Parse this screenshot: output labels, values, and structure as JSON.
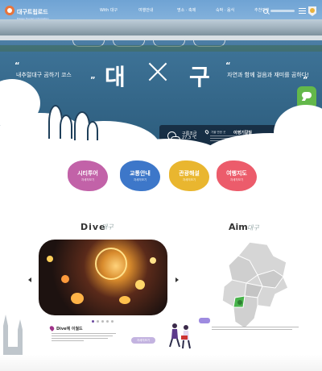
{
  "header": {
    "logo_text": "대구트립로드",
    "logo_sub": "Daegu Tourism Infomation",
    "nav": [
      "With 대구",
      "여행안내",
      "명소 · 축제",
      "숙박 · 음식",
      "추천여행"
    ]
  },
  "hero": {
    "tag_left": "내추럴대구 곰하기 코스",
    "tag_right": "자연과 함께 걸음과 재미를 곰하다!",
    "title_left": "대",
    "title_right": "구",
    "quote_open": "“",
    "quote_close": "”"
  },
  "weather": {
    "label": "구름조금",
    "temp": "27.3 ℃",
    "place_sub": "가볼 만한 곳",
    "place": "이영기갈질"
  },
  "categories": [
    {
      "label": "시티투어",
      "sub": "자세히보기",
      "color": "#c262a8"
    },
    {
      "label": "교통안내",
      "sub": "자세히보기",
      "color": "#3d77c9"
    },
    {
      "label": "관광해설",
      "sub": "자세히보기",
      "color": "#e9b62f"
    },
    {
      "label": "여행지도",
      "sub": "자세히보기",
      "color": "#ec5c6b"
    }
  ],
  "dive": {
    "title_a": "Dive",
    "title_b": "대구",
    "place_name": "Dive예 이월드",
    "more_label": "자세히보기",
    "dots": 5,
    "active_dot": 0
  },
  "aim": {
    "title": "Aim",
    "title_b": "대구"
  }
}
